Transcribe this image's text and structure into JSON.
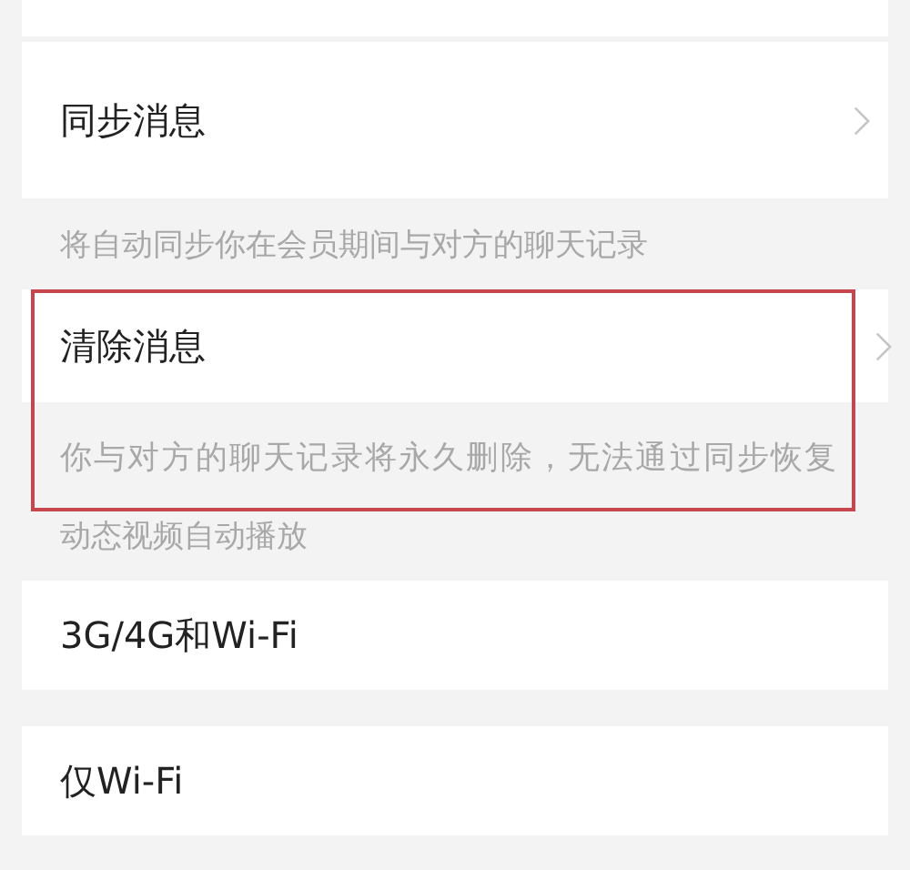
{
  "groups": [
    {
      "highlighted": false,
      "rows": [
        {
          "kind": "link",
          "title": "同步消息"
        },
        {
          "kind": "note",
          "title": "将自动同步你在会员期间与对方的聊天记录"
        }
      ]
    },
    {
      "highlighted": true,
      "rows": [
        {
          "kind": "link",
          "title": "清除消息"
        },
        {
          "kind": "note",
          "title": "你与对方的聊天记录将永久删除，无法通过同步恢复"
        }
      ]
    },
    {
      "highlighted": false,
      "rows": [
        {
          "kind": "header",
          "title": "动态视频自动播放"
        },
        {
          "kind": "option",
          "title": "3G/4G和Wi-Fi"
        },
        {
          "kind": "option",
          "title": "仅Wi-Fi"
        }
      ]
    }
  ]
}
